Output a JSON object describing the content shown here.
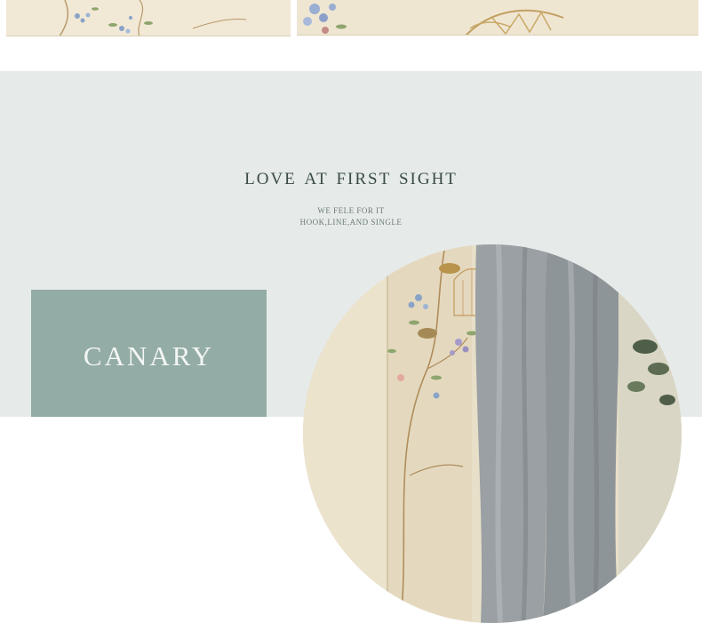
{
  "headline": "LOVE AT FIRST SIGHT",
  "subline_1": "WE FELE FOR IT",
  "subline_2": "HOOK,LINE,AND SINGLE",
  "product_label": "CANARY",
  "colors": {
    "section_bg": "#e6ebea",
    "label_box": "#93aca5",
    "headline_text": "#3a4a43",
    "curtain_gray": "#9a9fa3",
    "embroidery_cream": "#efe6d2"
  },
  "images": {
    "top_left": "embroidered floral curtain fabric",
    "top_right": "embroidered bird on branch fabric",
    "circle": "cream embroidered bird curtain beside gray velvet curtain"
  }
}
